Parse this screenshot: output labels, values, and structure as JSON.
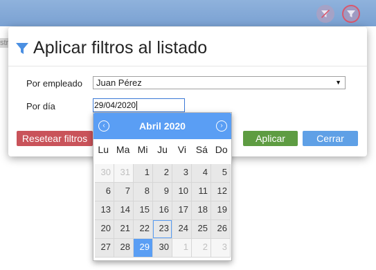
{
  "topbar": {
    "clear_filter_icon": "filter-off-icon",
    "active_filter_icon": "filter-icon"
  },
  "background": {
    "left_edge_text": "str"
  },
  "modal": {
    "icon": "filter-icon",
    "title": "Aplicar filtros al listado",
    "employee_label": "Por empleado",
    "employee_value": "Juan Pérez",
    "employee_arrow": "▼",
    "day_label": "Por día",
    "day_value": "29/04/2020",
    "buttons": {
      "reset": "Resetear filtros",
      "apply": "Aplicar",
      "close": "Cerrar"
    },
    "colors": {
      "reset": "#c9535a",
      "apply": "#5e9c42",
      "close": "#5fa0e6"
    }
  },
  "datepicker": {
    "prev_icon": "‹",
    "next_icon": "›",
    "month_title": "Abril 2020",
    "weekdays": [
      "Lu",
      "Ma",
      "Mi",
      "Ju",
      "Vi",
      "Sá",
      "Do"
    ],
    "accent_color": "#5a9ef4",
    "selected_day": "29",
    "today_day": "23",
    "days": [
      {
        "d": "30",
        "type": "other"
      },
      {
        "d": "31",
        "type": "other"
      },
      {
        "d": "1",
        "type": "cur"
      },
      {
        "d": "2",
        "type": "cur"
      },
      {
        "d": "3",
        "type": "cur"
      },
      {
        "d": "4",
        "type": "cur"
      },
      {
        "d": "5",
        "type": "cur"
      },
      {
        "d": "6",
        "type": "cur"
      },
      {
        "d": "7",
        "type": "cur"
      },
      {
        "d": "8",
        "type": "cur"
      },
      {
        "d": "9",
        "type": "cur"
      },
      {
        "d": "10",
        "type": "cur"
      },
      {
        "d": "11",
        "type": "cur"
      },
      {
        "d": "12",
        "type": "cur"
      },
      {
        "d": "13",
        "type": "cur"
      },
      {
        "d": "14",
        "type": "cur"
      },
      {
        "d": "15",
        "type": "cur"
      },
      {
        "d": "16",
        "type": "cur"
      },
      {
        "d": "17",
        "type": "cur"
      },
      {
        "d": "18",
        "type": "cur"
      },
      {
        "d": "19",
        "type": "cur"
      },
      {
        "d": "20",
        "type": "cur"
      },
      {
        "d": "21",
        "type": "cur"
      },
      {
        "d": "22",
        "type": "cur"
      },
      {
        "d": "23",
        "type": "today"
      },
      {
        "d": "24",
        "type": "cur"
      },
      {
        "d": "25",
        "type": "cur"
      },
      {
        "d": "26",
        "type": "cur"
      },
      {
        "d": "27",
        "type": "cur"
      },
      {
        "d": "28",
        "type": "cur"
      },
      {
        "d": "29",
        "type": "selected"
      },
      {
        "d": "30",
        "type": "cur"
      },
      {
        "d": "1",
        "type": "other"
      },
      {
        "d": "2",
        "type": "other"
      },
      {
        "d": "3",
        "type": "other"
      }
    ]
  }
}
